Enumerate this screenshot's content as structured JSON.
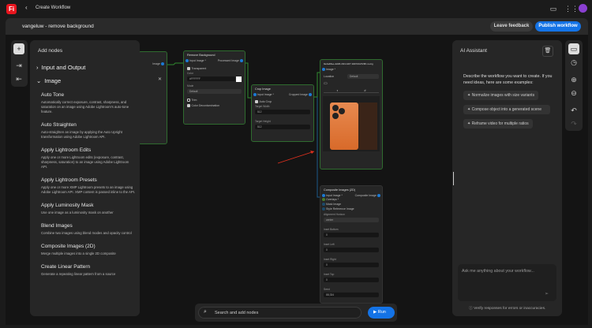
{
  "topbar": {
    "logo": "Fi",
    "back_icon": "chevron-left",
    "title": "Create Workflow"
  },
  "header": {
    "workflow_name": "vangeluw - remove background",
    "leave_feedback": "Leave feedback",
    "publish": "Publish workflow"
  },
  "add_nodes": {
    "title": "Add nodes",
    "sections": [
      {
        "label": "Input and Output",
        "expanded": false
      },
      {
        "label": "Image",
        "expanded": true
      }
    ],
    "items": [
      {
        "title": "Auto Tone",
        "desc": "Automatically correct exposure, contrast, sharpness, and saturation on an image using Adobe Lightroom's auto-tone feature."
      },
      {
        "title": "Auto Straighten",
        "desc": "Auto-straighten an image by applying the Auto Upright transformation using Adobe Lightroom API."
      },
      {
        "title": "Apply Lightroom Edits",
        "desc": "Apply one or more Lightroom edits (exposure, contrast, sharpness, saturation) to an image using Adobe Lightroom API."
      },
      {
        "title": "Apply Lightroom Presets",
        "desc": "Apply one or more XMP Lightroom presets to an image using Adobe Lightroom API. XMP content is passed inline to the API."
      },
      {
        "title": "Apply Luminosity Mask",
        "desc": "Use one image as a luminosity mask on another"
      },
      {
        "title": "Blend Images",
        "desc": "Combine two images using blend modes and opacity control"
      },
      {
        "title": "Composite Images (2D)",
        "desc": "Merge multiple images into a single 2D composite"
      },
      {
        "title": "Create Linear Pattern",
        "desc": "Generate a repeating linear pattern from a source"
      }
    ]
  },
  "nodes": {
    "partial": {
      "output": "Image"
    },
    "remove_bg": {
      "title": "Remove Background",
      "input": "Input Image *",
      "output": "Processed Image",
      "transparent": "Transparent",
      "color_label": "Color",
      "color_value": "#FFFFFF",
      "mode_label": "Mode",
      "mode_value": "Default",
      "trim": "Trim",
      "decontam": "Color Decontamination"
    },
    "crop": {
      "title": "Crop Image",
      "input": "Input Image *",
      "output": "Cropped Image",
      "auto_crop": "Auto Crop",
      "width_label": "Target Width",
      "width_value": "512",
      "height_label": "Target Height",
      "height_value": "512"
    },
    "output": {
      "title": "9e2a48ee-d2d8-4f13-b4f7-9407d3d72f0f-no-bg",
      "input": "Image *",
      "location_label": "Location",
      "location_value": "Default"
    },
    "composite": {
      "title": "Composite Images (2D)",
      "inputs": [
        "Input Image *",
        "Overlays *",
        "Mask Image",
        "Style Reference Image"
      ],
      "output": "Composite Image",
      "alignment_label": "Alignment Horizon",
      "alignment_value": "center",
      "fields": [
        {
          "label": "Inset Bottom",
          "value": "0"
        },
        {
          "label": "Inset Left",
          "value": "0"
        },
        {
          "label": "Inset Right",
          "value": "0"
        },
        {
          "label": "Inset Top",
          "value": "0"
        },
        {
          "label": "Seed",
          "value": "88,334"
        }
      ]
    }
  },
  "bottom": {
    "search_placeholder": "Search and add nodes",
    "run": "Run"
  },
  "ai": {
    "title": "AI Assistant",
    "intro": "Describe the workflow you want to create. If you need ideas, here are some examples:",
    "suggestions": [
      "Normalize images with size variants",
      "Compose object into a generated scene",
      "Reframe video for multiple ratios"
    ],
    "input_placeholder": "Ask me anything about your workflow...",
    "disclaimer": "Verify responses for errors or inaccuracies."
  },
  "colors": {
    "accent": "#1473e6",
    "node_border": "#2f6b2f",
    "port": "#1c7ad4",
    "annotation": "#e0301e"
  }
}
